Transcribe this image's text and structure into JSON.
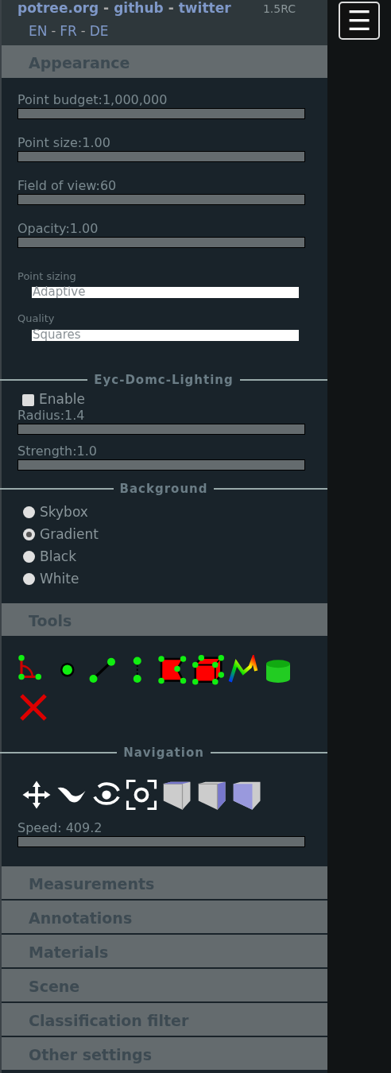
{
  "header": {
    "links": [
      {
        "kind": "link",
        "label": "potree.org"
      },
      {
        "kind": "separator",
        "label": "-"
      },
      {
        "kind": "link",
        "label": "github"
      },
      {
        "kind": "separator",
        "label": "-"
      },
      {
        "kind": "link",
        "label": "twitter"
      }
    ],
    "version": "1.5RC",
    "languages": [
      {
        "kind": "link",
        "label": "EN"
      },
      {
        "kind": "separator",
        "label": "-"
      },
      {
        "kind": "link",
        "label": "FR"
      },
      {
        "kind": "separator",
        "label": "-"
      },
      {
        "kind": "link",
        "label": "DE"
      }
    ]
  },
  "menu_button": {
    "label": "☰"
  },
  "appearance": {
    "title": "Appearance",
    "sliders": [
      {
        "label": "Point budget:1,000,000"
      },
      {
        "label": "Point size:1.00"
      },
      {
        "label": "Field of view:60"
      },
      {
        "label": "Opacity:1.00"
      }
    ],
    "selects": [
      {
        "label": "Point sizing",
        "value": "Adaptive"
      },
      {
        "label": "Quality",
        "value": "Squares"
      }
    ],
    "edl": {
      "title": "Eyc-Domc-Lighting",
      "enable": {
        "label": "Enable",
        "checked": false
      },
      "sliders": [
        {
          "label": "Radius:1.4"
        },
        {
          "label": "Strength:1.0"
        }
      ]
    },
    "background": {
      "title": "Background",
      "options": [
        {
          "label": "Skybox",
          "selected": false
        },
        {
          "label": "Gradient",
          "selected": true
        },
        {
          "label": "Black",
          "selected": false
        },
        {
          "label": "White",
          "selected": false
        }
      ]
    }
  },
  "tools": {
    "title": "Tools",
    "items": [
      {
        "kind": "angle"
      },
      {
        "kind": "point"
      },
      {
        "kind": "distance"
      },
      {
        "kind": "height"
      },
      {
        "kind": "area"
      },
      {
        "kind": "volume"
      },
      {
        "kind": "profile"
      },
      {
        "kind": "clip"
      },
      {
        "kind": "remove"
      }
    ],
    "navigation": {
      "title": "Navigation",
      "items": [
        {
          "kind": "move"
        },
        {
          "kind": "fly"
        },
        {
          "kind": "orbit"
        },
        {
          "kind": "focus"
        },
        {
          "kind": "view_left"
        },
        {
          "kind": "view_front"
        },
        {
          "kind": "view_top"
        }
      ],
      "speed": {
        "label": "Speed: 409.2"
      }
    }
  },
  "sections": [
    {
      "title": "Measurements"
    },
    {
      "title": "Annotations"
    },
    {
      "title": "Materials"
    },
    {
      "title": "Scene"
    },
    {
      "title": "Classification filter"
    },
    {
      "title": "Other settings"
    }
  ]
}
